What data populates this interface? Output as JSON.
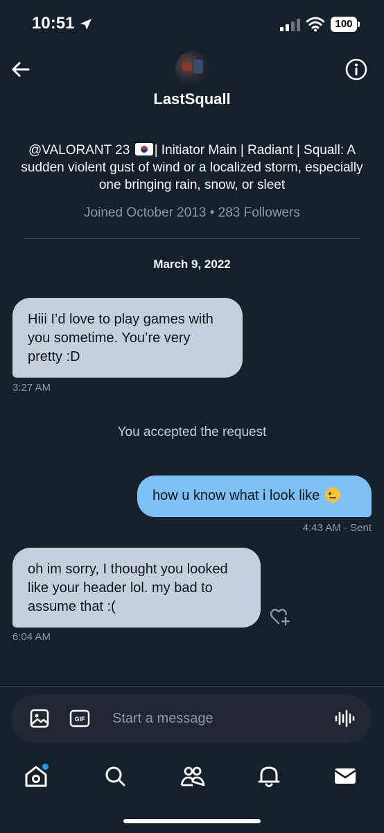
{
  "status_bar": {
    "time": "10:51",
    "battery": "100",
    "icons": [
      "location-arrow-icon",
      "cellular-signal-icon",
      "wifi-icon",
      "battery-icon"
    ]
  },
  "header": {
    "back_icon": "arrow-left-icon",
    "info_icon": "info-icon"
  },
  "profile": {
    "name": "LastSquall",
    "bio_line1_before_flag": "@VALORANT 23",
    "bio_line1_after_flag": "| Initiator Main | Radiant |",
    "bio_rest": "Squall: A sudden violent gust of wind or a localized storm, especially one bringing rain, snow, or sleet",
    "meta": "Joined October 2013 • 283 Followers"
  },
  "conversation": {
    "date": "March 9, 2022",
    "messages": [
      {
        "direction": "incoming",
        "text": "Hiii I’d love to play games with you sometime. You’re very pretty :D",
        "time": "3:27 AM"
      },
      {
        "direction": "outgoing",
        "text": "how u know what i look like",
        "time": "4:43 AM · Sent"
      },
      {
        "direction": "incoming",
        "text": "oh im sorry, I thought you looked like your header lol. my bad to assume that :(",
        "time": "6:04 AM"
      }
    ],
    "system_message": "You accepted the request"
  },
  "composer": {
    "placeholder": "Start a message",
    "value": "",
    "gif_label": "GIF",
    "icons": [
      "image-icon",
      "gif-icon",
      "voice-icon"
    ]
  },
  "tab_bar": {
    "items": [
      "home-icon",
      "search-icon",
      "communities-icon",
      "notifications-icon",
      "messages-icon"
    ]
  },
  "colors": {
    "background": "#15202B",
    "incoming_bubble": "#C4D0DB",
    "outgoing_bubble": "#7CC0F6",
    "accent": "#1D9BF0",
    "muted_text": "#8B98A5"
  }
}
